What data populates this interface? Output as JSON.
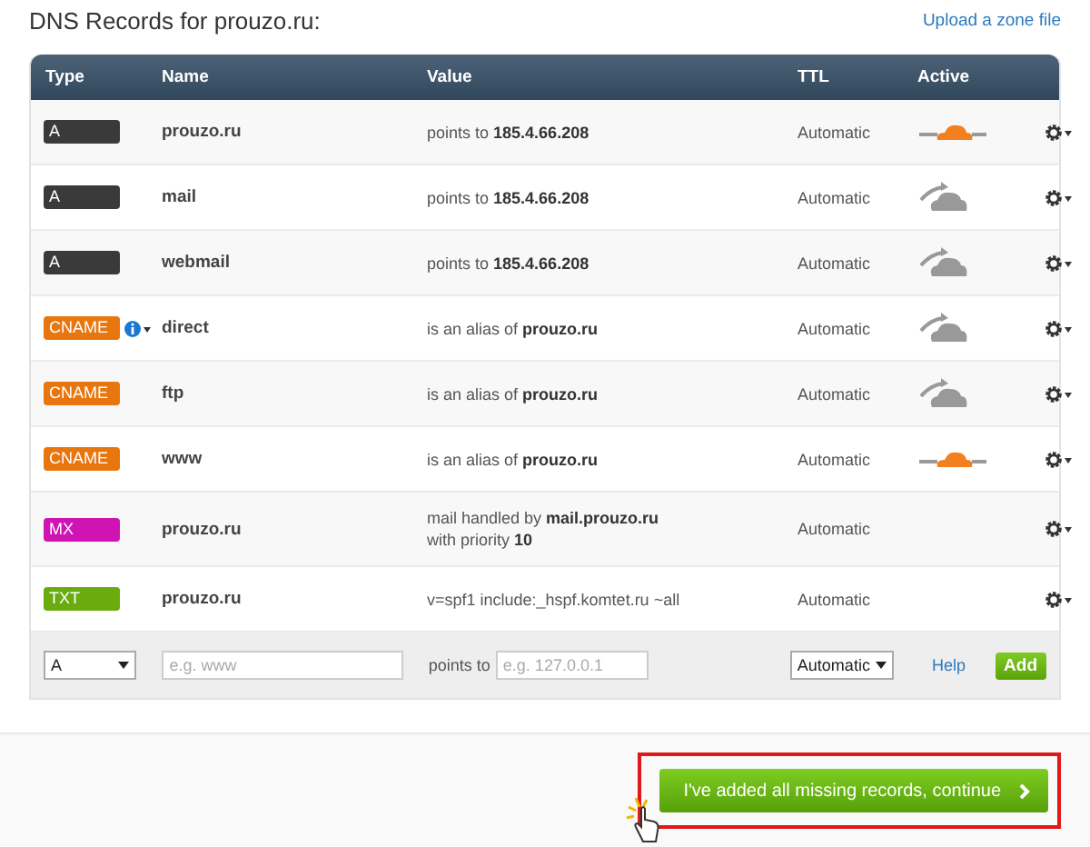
{
  "title": "DNS Records for prouzo.ru:",
  "upload_link": "Upload a zone file",
  "table": {
    "columns": [
      "Type",
      "Name",
      "Value",
      "TTL",
      "Active"
    ],
    "rows": [
      {
        "type": "A",
        "color": "#3a3a3a",
        "name": "prouzo.ru",
        "info": false,
        "value_lines": [
          "points to **185.4.66.208**"
        ],
        "ttl": "Automatic",
        "proxied": true
      },
      {
        "type": "A",
        "color": "#3a3a3a",
        "name": "mail",
        "info": false,
        "value_lines": [
          "points to **185.4.66.208**"
        ],
        "ttl": "Automatic",
        "proxied": false
      },
      {
        "type": "A",
        "color": "#3a3a3a",
        "name": "webmail",
        "info": false,
        "value_lines": [
          "points to **185.4.66.208**"
        ],
        "ttl": "Automatic",
        "proxied": false
      },
      {
        "type": "CNAME",
        "color": "#e8760e",
        "name": "direct",
        "info": true,
        "value_lines": [
          "is an alias of **prouzo.ru**"
        ],
        "ttl": "Automatic",
        "proxied": false
      },
      {
        "type": "CNAME",
        "color": "#e8760e",
        "name": "ftp",
        "info": false,
        "value_lines": [
          "is an alias of **prouzo.ru**"
        ],
        "ttl": "Automatic",
        "proxied": false
      },
      {
        "type": "CNAME",
        "color": "#e8760e",
        "name": "www",
        "info": false,
        "value_lines": [
          "is an alias of **prouzo.ru**"
        ],
        "ttl": "Automatic",
        "proxied": true
      },
      {
        "type": "MX",
        "color": "#d014b4",
        "name": "prouzo.ru",
        "info": false,
        "value_lines": [
          "mail handled by **mail.prouzo.ru**",
          "with priority **10**"
        ],
        "ttl": "Automatic"
      },
      {
        "type": "TXT",
        "color": "#6aab0e",
        "name": "prouzo.ru",
        "info": false,
        "value_lines": [
          "v=spf1 include:_hspf.komtet.ru ~all"
        ],
        "ttl": "Automatic"
      }
    ]
  },
  "add_form": {
    "type_value": "A",
    "name_placeholder": "e.g. www",
    "points_label": "points to",
    "value_placeholder": "e.g. 127.0.0.1",
    "ttl_value": "Automatic",
    "help_link": "Help",
    "add_button": "Add"
  },
  "continue_button": "I've added all missing records, continue"
}
